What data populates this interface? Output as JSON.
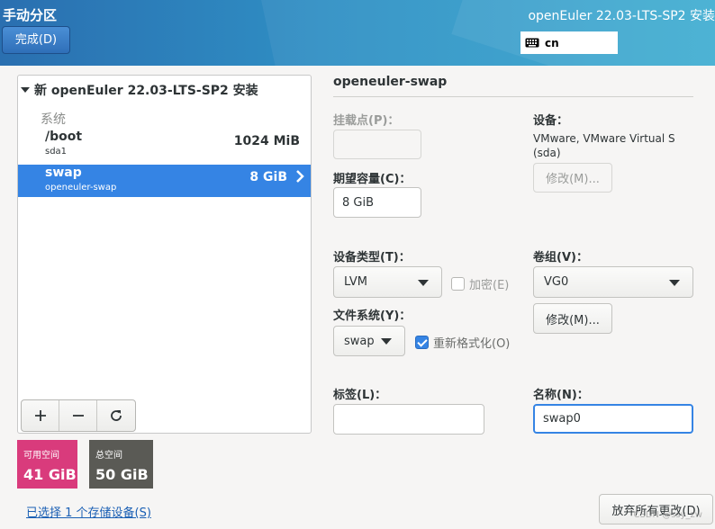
{
  "header": {
    "page_title": "手动分区",
    "product_title": "openEuler 22.03-LTS-SP2 安装",
    "done_label": "完成(D)",
    "keyboard_layout": "cn"
  },
  "left": {
    "install_title": "新 openEuler 22.03-LTS-SP2 安装",
    "group_label": "系统",
    "mountpoints": [
      {
        "name": "/boot",
        "device": "sda1",
        "size": "1024 MiB",
        "selected": false
      },
      {
        "name": "swap",
        "device": "openeuler-swap",
        "size": "8 GiB",
        "selected": true
      }
    ],
    "toolbar": {
      "add": "+",
      "remove": "−",
      "refresh": "↻"
    }
  },
  "space": {
    "available_label": "可用空间",
    "available_value": "41 GiB",
    "total_label": "总空间",
    "total_value": "50 GiB",
    "available_color": "#d93b7c",
    "total_color": "#5a5a55"
  },
  "storage_link": "已选择 1 个存储设备(S)",
  "discard_label": "放弃所有更改(D)",
  "watermark": "CSDN @ssy_zw",
  "details": {
    "title": "openeuler-swap",
    "mount_point_label": "挂载点(P)：",
    "mount_point_value": "",
    "capacity_label": "期望容量(C)：",
    "capacity_value": "8 GiB",
    "device_label": "设备：",
    "device_value": "VMware, VMware Virtual S (sda)",
    "modify_disabled_label": "修改(M)...",
    "device_type_label": "设备类型(T)：",
    "device_type_value": "LVM",
    "encrypt_label": "加密(E)",
    "encrypt_checked": false,
    "volume_group_label": "卷组(V)：",
    "volume_group_value": "VG0",
    "modify_label": "修改(M)...",
    "filesystem_label": "文件系统(Y)：",
    "filesystem_value": "swap",
    "reformat_label": "重新格式化(O)",
    "reformat_checked": true,
    "tag_label": "标签(L)：",
    "tag_value": "",
    "name_label": "名称(N)：",
    "name_value": "swap0"
  }
}
